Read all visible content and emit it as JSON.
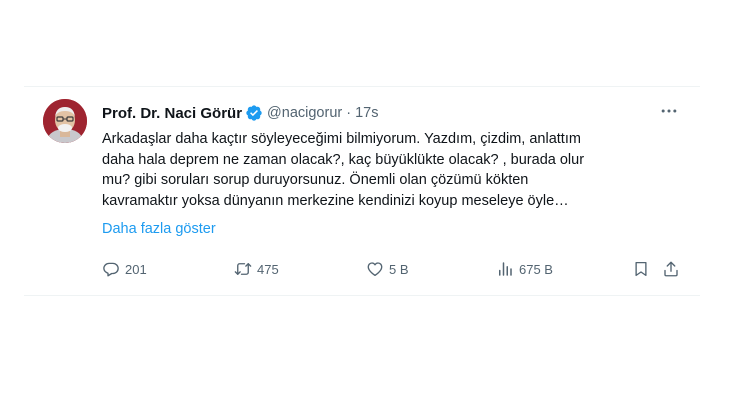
{
  "tweet": {
    "author": {
      "display_name": "Prof. Dr. Naci Görür",
      "handle": "@nacigorur",
      "verified": true
    },
    "separator": "·",
    "time": "17s",
    "text_lines": [
      "Arkadaşlar daha kaçtır söyleyeceğimi bilmiyorum. Yazdım, çizdim, anlattım",
      "daha hala deprem ne zaman olacak?, kaç büyüklükte olacak? , burada olur",
      "mu? gibi  soruları sorup duruyorsunuz. Önemli olan çözümü kökten",
      "kavramaktır yoksa dünyanın merkezine kendinizi koyup  meseleye öyle…"
    ],
    "show_more": "Daha fazla göster",
    "stats": {
      "replies": "201",
      "retweets": "475",
      "likes": "5 B",
      "views": "675 B"
    }
  },
  "icons": {
    "verified": "verified-badge-icon",
    "more": "more-horizontal-icon",
    "reply": "reply-icon",
    "retweet": "retweet-icon",
    "like": "heart-icon",
    "views": "views-chart-icon",
    "bookmark": "bookmark-icon",
    "share": "share-icon"
  },
  "colors": {
    "text": "#0f1419",
    "muted": "#536471",
    "link": "#1d9bf0",
    "verified": "#1d9bf0",
    "divider": "#eff3f4"
  }
}
